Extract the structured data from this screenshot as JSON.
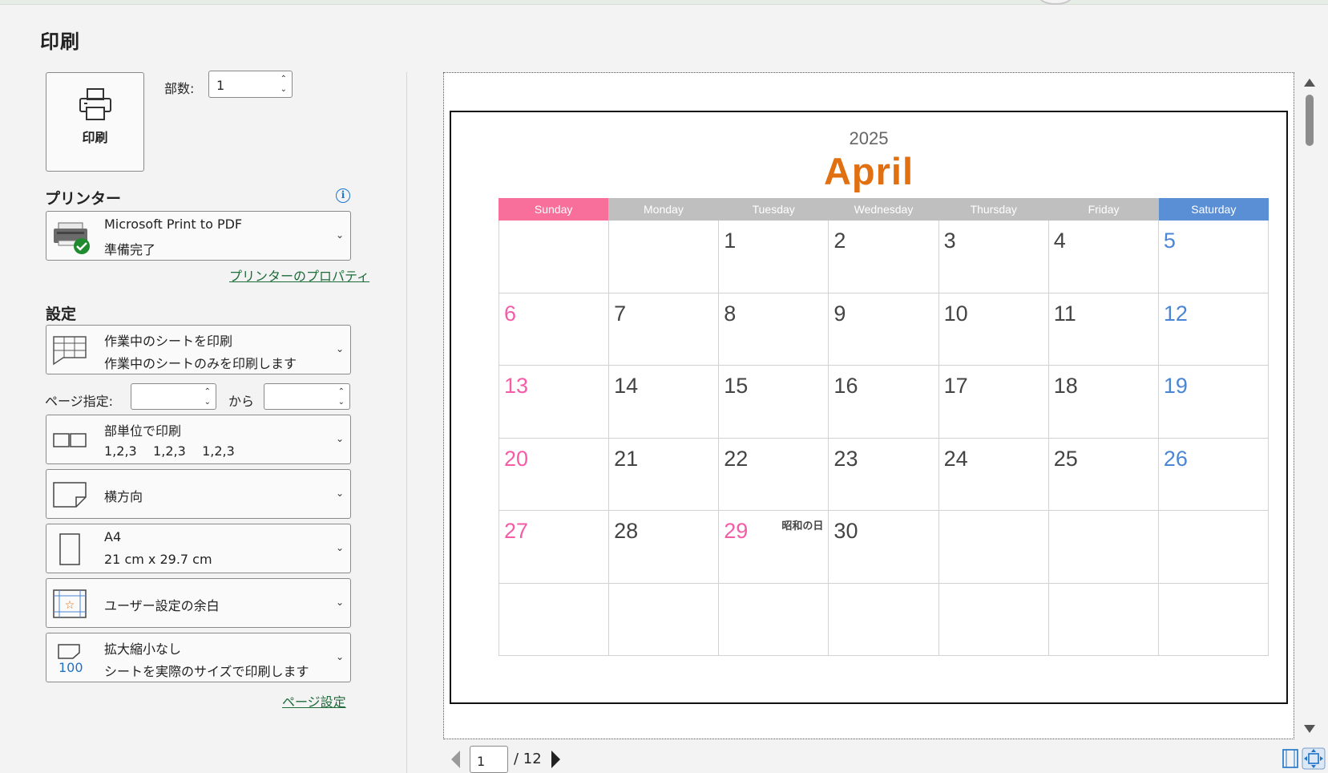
{
  "title": "印刷",
  "print_button": {
    "label": "印刷"
  },
  "copies": {
    "label": "部数:",
    "value": "1"
  },
  "printer": {
    "heading": "プリンター",
    "name": "Microsoft Print to PDF",
    "status": "準備完了",
    "properties_link": "プリンターのプロパティ"
  },
  "settings": {
    "heading": "設定",
    "what": {
      "title": "作業中のシートを印刷",
      "desc": "作業中のシートのみを印刷します"
    },
    "pages": {
      "label": "ページ指定:",
      "from": "",
      "to_label": "から",
      "to": ""
    },
    "collate": {
      "title": "部単位で印刷",
      "desc": "1,2,3    1,2,3    1,2,3"
    },
    "orientation": {
      "title": "横方向"
    },
    "paper": {
      "title": "A4",
      "desc": "21 cm x 29.7 cm"
    },
    "margins": {
      "title": "ユーザー設定の余白"
    },
    "scaling": {
      "title": "拡大縮小なし",
      "desc": "シートを実際のサイズで印刷します",
      "icon_text": "100"
    },
    "page_setup_link": "ページ設定"
  },
  "preview": {
    "calendar": {
      "year": "2025",
      "month": "April",
      "weekdays": [
        "Sunday",
        "Monday",
        "Tuesday",
        "Wednesday",
        "Thursday",
        "Friday",
        "Saturday"
      ],
      "weekday_colors": [
        "#f76f9a",
        "#bfbfbf",
        "#bfbfbf",
        "#bfbfbf",
        "#bfbfbf",
        "#bfbfbf",
        "#5a8fd6"
      ],
      "weeks": [
        [
          "",
          "",
          "1",
          "2",
          "3",
          "4",
          "5"
        ],
        [
          "6",
          "7",
          "8",
          "9",
          "10",
          "11",
          "12"
        ],
        [
          "13",
          "14",
          "15",
          "16",
          "17",
          "18",
          "19"
        ],
        [
          "20",
          "21",
          "22",
          "23",
          "24",
          "25",
          "26"
        ],
        [
          "27",
          "28",
          "29",
          "30",
          "",
          "",
          ""
        ],
        [
          "",
          "",
          "",
          "",
          "",
          "",
          ""
        ]
      ],
      "holiday": {
        "date": "29",
        "name": "昭和の日"
      }
    }
  },
  "pager": {
    "current": "1",
    "total": "/ 12"
  },
  "colors": {
    "accent_link": "#1e6b3a",
    "info_blue": "#1976d2",
    "month_orange": "#e07010",
    "sunday_pink": "#f55ca7",
    "saturday_blue": "#4a86d4"
  }
}
